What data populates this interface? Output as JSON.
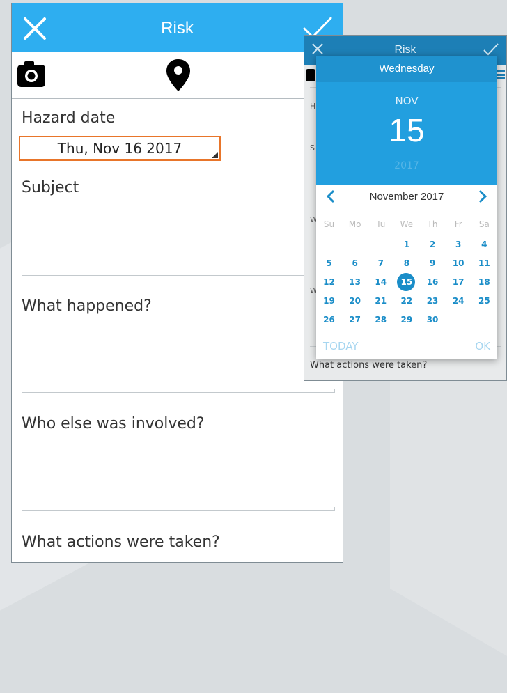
{
  "main": {
    "title": "Risk",
    "hazard_label": "Hazard date",
    "hazard_value": "Thu, Nov 16 2017",
    "subject_label": "Subject",
    "what_happened_label": "What happened?",
    "who_else_label": "Who else was involved?",
    "actions_label": "What actions were taken?"
  },
  "secondary": {
    "title": "Risk",
    "left_letters": [
      "H",
      "S",
      "W",
      "W"
    ],
    "footer_label": "What actions were taken?"
  },
  "picker": {
    "weekday": "Wednesday",
    "month_short": "NOV",
    "day": "15",
    "year": "2017",
    "month_label": "November 2017",
    "dow": [
      "Su",
      "Mo",
      "Tu",
      "We",
      "Th",
      "Fr",
      "Sa"
    ],
    "days": [
      "1",
      "2",
      "3",
      "4",
      "5",
      "6",
      "7",
      "8",
      "9",
      "10",
      "11",
      "12",
      "13",
      "14",
      "15",
      "16",
      "17",
      "18",
      "19",
      "20",
      "21",
      "22",
      "23",
      "24",
      "25",
      "26",
      "27",
      "28",
      "29",
      "30"
    ],
    "first_weekday": 3,
    "selected_day": 15,
    "today_label": "TODAY",
    "ok_label": "OK"
  },
  "colors": {
    "header": "#2eaef0",
    "accent": "#1a8dc8",
    "date_border": "#e8752a"
  },
  "icons": [
    "close-icon",
    "check-icon",
    "camera-icon",
    "location-pin-icon",
    "chevron-left-icon",
    "chevron-right-icon",
    "menu-icon"
  ]
}
